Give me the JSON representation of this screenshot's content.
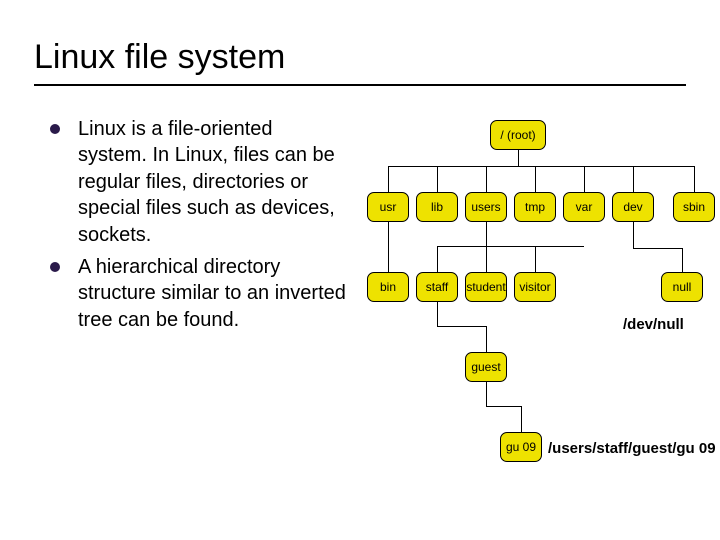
{
  "title": "Linux file system",
  "bullets": [
    "Linux is a file-oriented system. In Linux, files can be regular files, directories or special files such as devices, sockets.",
    "A hierarchical directory structure similar to an inverted tree can be found."
  ],
  "nodes": {
    "root": "/ (root)",
    "usr": "usr",
    "lib": "lib",
    "users": "users",
    "tmp": "tmp",
    "var": "var",
    "dev": "dev",
    "sbin": "sbin",
    "bin": "bin",
    "staff": "staff",
    "student": "student",
    "visitor": "visitor",
    "null": "null",
    "guest": "guest",
    "gu09": "gu 09"
  },
  "annotations": {
    "devnull": "/dev/null",
    "path": "/users/staff/guest/gu 09"
  }
}
